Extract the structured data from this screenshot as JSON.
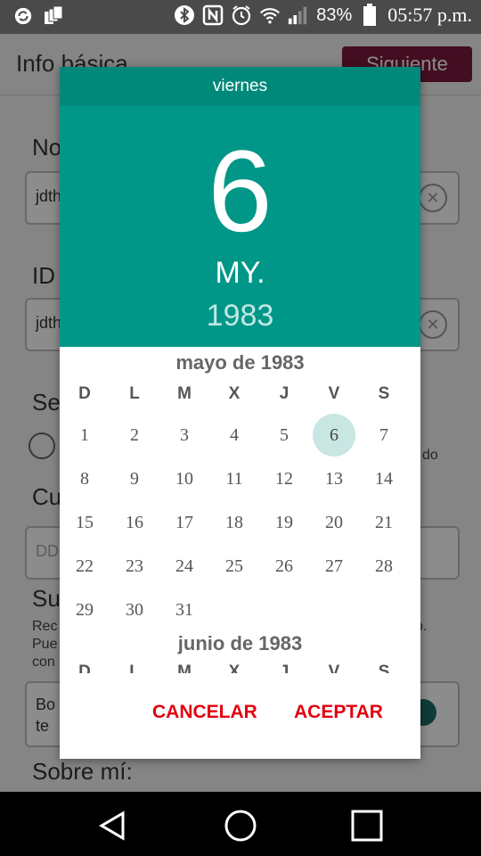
{
  "status_bar": {
    "battery": "83%",
    "time": "05:57 p.m.",
    "left_icons": [
      "sync-icon",
      "sim-cards-icon"
    ],
    "right_icons": [
      "bluetooth-icon",
      "nfc-icon",
      "alarm-icon",
      "wifi-icon",
      "signal-icon",
      "battery-icon"
    ]
  },
  "background": {
    "title": "Info básica",
    "next_button": "Siguiente",
    "labels": [
      "No",
      "ID",
      "Se",
      "Cu",
      "Su",
      "Sobre mí:"
    ],
    "field1_value": "jdth",
    "field2_value": "jdth",
    "field3_placeholder": "DD",
    "side_text": "do",
    "para_lines": [
      "Rec",
      "Pue",
      "con"
    ],
    "para_end": "o.",
    "box_lines": [
      "Bo",
      "te"
    ]
  },
  "dialog": {
    "day_name": "viernes",
    "day_number": "6",
    "month_abbr": "MY.",
    "year": "1983",
    "weekdays": [
      "D",
      "L",
      "M",
      "X",
      "J",
      "V",
      "S"
    ],
    "months": [
      {
        "title": "mayo de 1983",
        "weeks": [
          [
            "1",
            "2",
            "3",
            "4",
            "5",
            "6",
            "7"
          ],
          [
            "8",
            "9",
            "10",
            "11",
            "12",
            "13",
            "14"
          ],
          [
            "15",
            "16",
            "17",
            "18",
            "19",
            "20",
            "21"
          ],
          [
            "22",
            "23",
            "24",
            "25",
            "26",
            "27",
            "28"
          ],
          [
            "29",
            "30",
            "31",
            "",
            "",
            "",
            ""
          ]
        ],
        "selected_day": "6"
      },
      {
        "title": "junio de 1983"
      }
    ],
    "cancel_label": "CANCELAR",
    "accept_label": "ACEPTAR",
    "accent_color": "#009688",
    "button_color": "#e3000f"
  },
  "navbar": {
    "icons": [
      "back-icon",
      "home-icon",
      "recents-icon"
    ]
  }
}
